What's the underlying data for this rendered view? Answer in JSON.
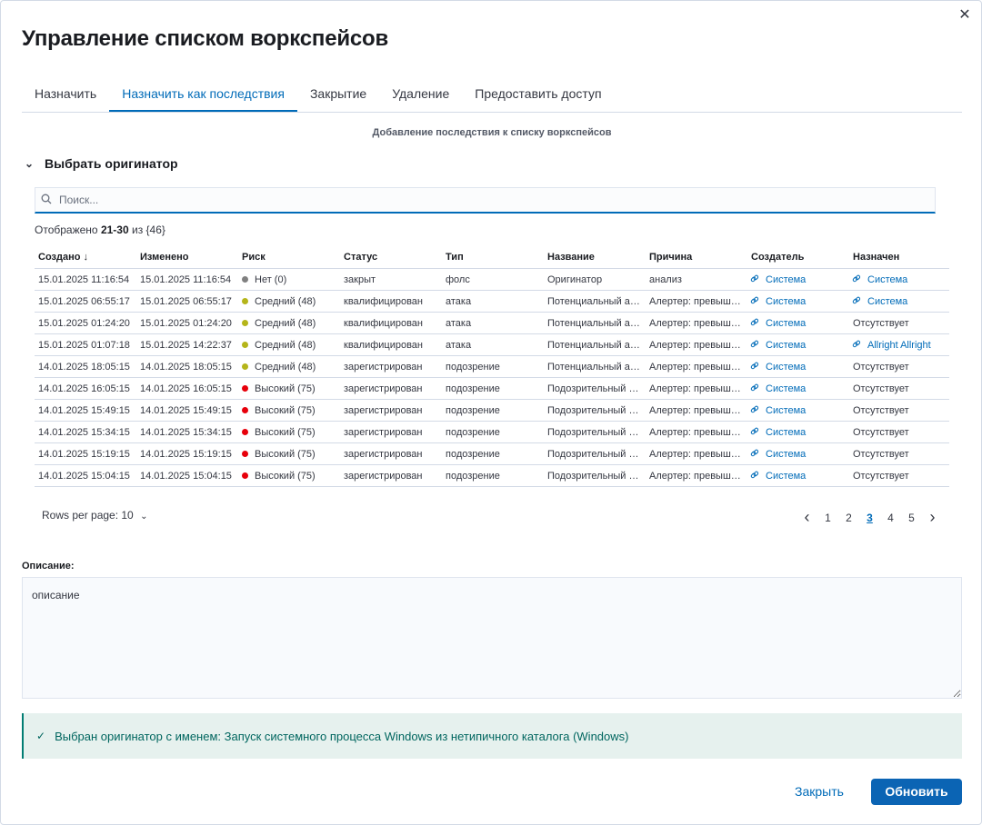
{
  "modal": {
    "title": "Управление списком воркспейсов",
    "close_glyph": "✕"
  },
  "tabs": [
    {
      "label": "Назначить"
    },
    {
      "label": "Назначить как последствия",
      "active": true
    },
    {
      "label": "Закрытие"
    },
    {
      "label": "Удаление"
    },
    {
      "label": "Предоставить доступ"
    }
  ],
  "subtitle": "Добавление последствия к списку воркспейсов",
  "accordion": {
    "label": "Выбрать оригинатор",
    "icon": "chevron-down-icon"
  },
  "search": {
    "placeholder": "Поиск...",
    "icon": "search-icon"
  },
  "showing": {
    "prefix": "Отображено",
    "range": "21-30",
    "of": "из",
    "total": "{46}"
  },
  "table": {
    "columns": [
      "Создано ↓",
      "Изменено",
      "Риск",
      "Статус",
      "Тип",
      "Название",
      "Причина",
      "Создатель",
      "Назначен"
    ],
    "rows": [
      {
        "created": "15.01.2025 11:16:54",
        "modified": "15.01.2025 11:16:54",
        "risk": "Нет (0)",
        "risk_color": "#808080",
        "status": "закрыт",
        "type": "фолс",
        "name": "Оригинатор",
        "reason": "анализ",
        "creator": "Система",
        "assignee": "Система",
        "assignee_link": true
      },
      {
        "created": "15.01.2025 06:55:17",
        "modified": "15.01.2025 06:55:17",
        "risk": "Средний (48)",
        "risk_color": "#b5b51a",
        "status": "квалифицирован",
        "type": "атака",
        "name": "Потенциальный ап...",
        "reason": "Алертер: превыше...",
        "creator": "Система",
        "assignee": "Система",
        "assignee_link": true
      },
      {
        "created": "15.01.2025 01:24:20",
        "modified": "15.01.2025 01:24:20",
        "risk": "Средний (48)",
        "risk_color": "#b5b51a",
        "status": "квалифицирован",
        "type": "атака",
        "name": "Потенциальный ап...",
        "reason": "Алертер: превыше...",
        "creator": "Система",
        "assignee": "Отсутствует",
        "assignee_link": false
      },
      {
        "created": "15.01.2025 01:07:18",
        "modified": "15.01.2025 14:22:37",
        "risk": "Средний (48)",
        "risk_color": "#b5b51a",
        "status": "квалифицирован",
        "type": "атака",
        "name": "Потенциальный ап...",
        "reason": "Алертер: превыше...",
        "creator": "Система",
        "assignee": "Allright Allright",
        "assignee_link": true
      },
      {
        "created": "14.01.2025 18:05:15",
        "modified": "14.01.2025 18:05:15",
        "risk": "Средний (48)",
        "risk_color": "#b5b51a",
        "status": "зарегистрирован",
        "type": "подозрение",
        "name": "Потенциальный ап...",
        "reason": "Алертер: превыше...",
        "creator": "Система",
        "assignee": "Отсутствует",
        "assignee_link": false
      },
      {
        "created": "14.01.2025 16:05:15",
        "modified": "14.01.2025 16:05:15",
        "risk": "Высокий (75)",
        "risk_color": "#e7000b",
        "status": "зарегистрирован",
        "type": "подозрение",
        "name": "Подозрительный д...",
        "reason": "Алертер: превыше...",
        "creator": "Система",
        "assignee": "Отсутствует",
        "assignee_link": false
      },
      {
        "created": "14.01.2025 15:49:15",
        "modified": "14.01.2025 15:49:15",
        "risk": "Высокий (75)",
        "risk_color": "#e7000b",
        "status": "зарегистрирован",
        "type": "подозрение",
        "name": "Подозрительный д...",
        "reason": "Алертер: превыше...",
        "creator": "Система",
        "assignee": "Отсутствует",
        "assignee_link": false
      },
      {
        "created": "14.01.2025 15:34:15",
        "modified": "14.01.2025 15:34:15",
        "risk": "Высокий (75)",
        "risk_color": "#e7000b",
        "status": "зарегистрирован",
        "type": "подозрение",
        "name": "Подозрительный д...",
        "reason": "Алертер: превыше...",
        "creator": "Система",
        "assignee": "Отсутствует",
        "assignee_link": false
      },
      {
        "created": "14.01.2025 15:19:15",
        "modified": "14.01.2025 15:19:15",
        "risk": "Высокий (75)",
        "risk_color": "#e7000b",
        "status": "зарегистрирован",
        "type": "подозрение",
        "name": "Подозрительный д...",
        "reason": "Алертер: превыше...",
        "creator": "Система",
        "assignee": "Отсутствует",
        "assignee_link": false
      },
      {
        "created": "14.01.2025 15:04:15",
        "modified": "14.01.2025 15:04:15",
        "risk": "Высокий (75)",
        "risk_color": "#e7000b",
        "status": "зарегистрирован",
        "type": "подозрение",
        "name": "Подозрительный д...",
        "reason": "Алертер: превыше...",
        "creator": "Система",
        "assignee": "Отсутствует",
        "assignee_link": false
      }
    ]
  },
  "pagination": {
    "rows_per_page_label": "Rows per page: 10",
    "pages": [
      "1",
      "2",
      "3",
      "4",
      "5"
    ],
    "current": "3",
    "prev_glyph": "‹",
    "next_glyph": "›"
  },
  "description": {
    "label": "Описание:",
    "value": "описание"
  },
  "callout": {
    "text": "Выбран оригинатор с именем: Запуск системного процесса Windows из нетипичного каталога (Windows)",
    "icon": "check-icon"
  },
  "footer": {
    "close_label": "Закрыть",
    "update_label": "Обновить"
  },
  "colors": {
    "accent": "#006bb8",
    "primary_button": "#0b64b4",
    "success_bg": "#e6f1ee",
    "success_text": "#00665f"
  }
}
